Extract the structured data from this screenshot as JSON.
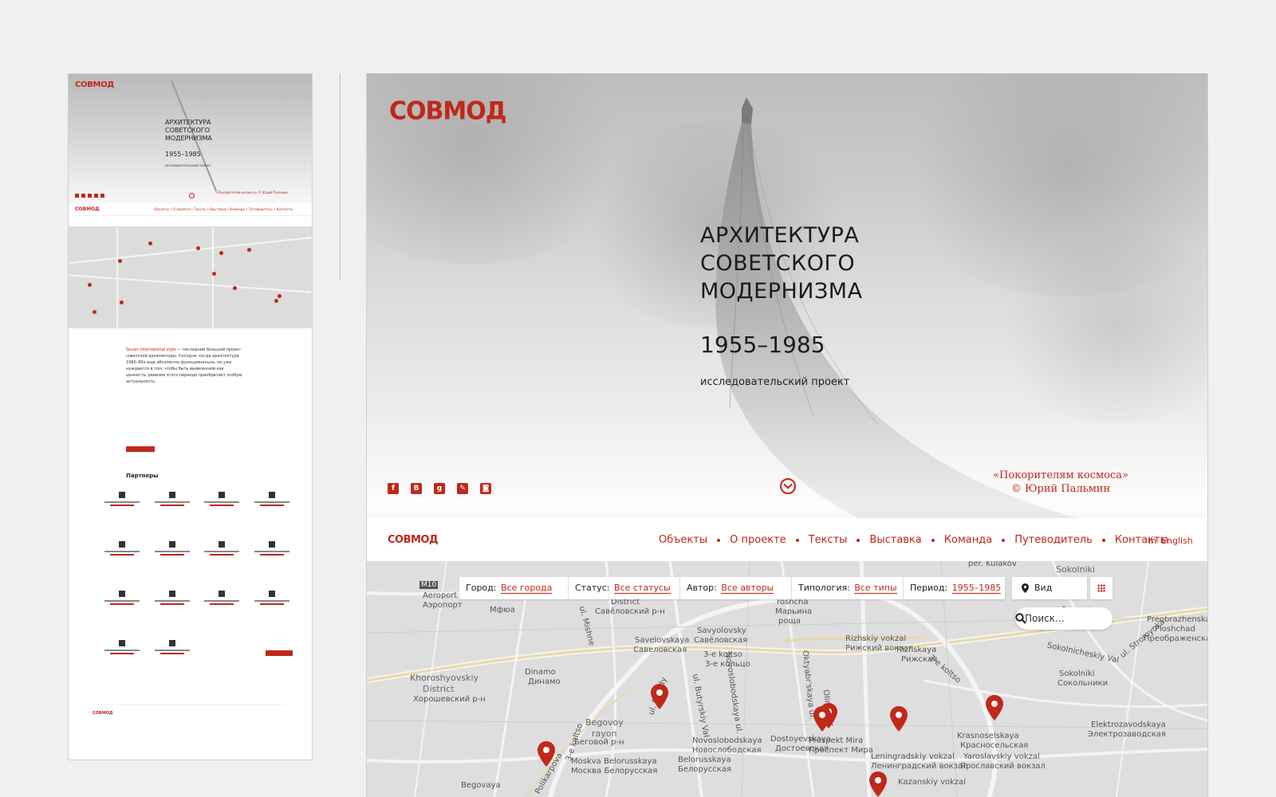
{
  "thumb": {
    "logo": "СОВМОД",
    "title": "АРХИТЕКТУРА СОВЕТСКОГО МОДЕРНИЗМА",
    "years": "1955–1985",
    "subtitle": "исследовательский проект",
    "credit": "«Покорителям космоса» © Юрий Пальмин",
    "nav": "Объекты • О проекте • Тексты • Выставка • Команда • Путеводитель • Контакты",
    "intro_highlight": "Soviet international style",
    "intro_text": " — последний большой проект советской архитектуры. Сегодня, когда архитектура 1960–80х еще абсолютно функциональна, но уже нуждается в том, чтобы быть выявленной как ценность, ревизия этого периода приобретает особую актуальность.",
    "partners_title": "Партнеры"
  },
  "hero": {
    "logo": "СОВМОД",
    "title_lines": [
      "АРХИТЕКТУРА",
      "СОВЕТСКОГО",
      "МОДЕРНИЗМА"
    ],
    "years": "1955–1985",
    "subtitle": "исследовательский проект",
    "credit_line1": "«Покорителям космоса»",
    "credit_line2": "© Юрий Пальмин",
    "social": [
      "f",
      "В",
      "g",
      "✎",
      "◙"
    ]
  },
  "nav": {
    "logo": "СОВМОД",
    "items": [
      "Объекты",
      "О проекте",
      "Тексты",
      "Выставка",
      "Команда",
      "Путеводитель",
      "Контакты"
    ],
    "lang_prefix": "in",
    "lang": "English"
  },
  "filters": [
    {
      "label": "Город:",
      "value": "Все города"
    },
    {
      "label": "Статус:",
      "value": "Все статусы"
    },
    {
      "label": "Автор:",
      "value": "Все авторы"
    },
    {
      "label": "Типология:",
      "value": "Все типы"
    },
    {
      "label": "Период:",
      "value": "1955–1985"
    }
  ],
  "map_controls": {
    "view_label": "Вид картой",
    "search_placeholder": "Поиск..."
  },
  "map_labels": {
    "m10": "M10",
    "aeroport": "Aeroport",
    "aeroport_ru": "Аэропорт",
    "mfua": "Мфюа",
    "district": "District",
    "savelovsky_r": "Савёловский р-н",
    "roshcha": "roshcha",
    "marina": "Марьина",
    "roshcha_ru": "роща",
    "savelovskaya": "Savelovskaya",
    "savelovskaya_ru": "Савеловская",
    "savyolovsky": "Savyolovsky",
    "savyolovskaya_ru": "Савёловская",
    "rizhsky_vokzal": "Rizhskiy vokzal",
    "rizhsky_vokzal_ru": "Рижский вокзал",
    "rizhskaya": "Rizhskaya",
    "rizhskaya_ru": "Рижская",
    "koltso": "3-e koltso",
    "koltso_ru": "3-е кольцо",
    "koltso2": "3-e koltso",
    "khoroshevsky": "Khoroshyovskiy",
    "khoroshevsky2": "District",
    "khoroshevsky_ru": "Хорошевский р-н",
    "dinamo": "Dinamo",
    "dinamo_ru": "Динамо",
    "begovoy": "Begovoy",
    "begovoy2": "rayon",
    "begovoy_ru": "Беговой р-н",
    "novoslobodskaya": "Novoslobodskaya",
    "novoslobodskaya_ru": "Новослободская",
    "dostoyevskaya": "Dostoyevskaya",
    "dostoyevskaya_ru": "Достоевская",
    "prospekt_mira": "Prospekt Mira",
    "prospekt_mira_ru": "Проспект Мира",
    "moskva_bel": "Moskva Belorusskaya",
    "moskva_bel_ru": "Москва Белорусская",
    "belorusskaya": "Belorusskaya",
    "belorusskaya_ru": "Белорусская",
    "begovaya": "Begovaya",
    "leningradsky": "Leningradskiy vokzal",
    "leningradsky_ru": "Ленинградский вокзал",
    "yaroslavsky": "Yaroslavskiy vokzal",
    "yaroslavsky_ru": "Ярославский вокзал",
    "kazansky": "Kazanskiy vokzal",
    "krasnoselskaya": "Krasnoselskaya",
    "krasnoselskaya_ru": "Красносельская",
    "sokolniki": "Sokolniki",
    "sokolniki_ru": "Сокольники",
    "sokolniki_top": "Sokolniki",
    "sokolnicheskiy": "Sokolnicheskiy Val",
    "preobrazhenskaya": "Preobrazhenska",
    "ploshchad": "Ploshchad",
    "preobr_ru": "Преображенская",
    "elektrozavodskaya": "Elektrozavodskaya",
    "elektrozavodskaya_ru": "Электрозаводская",
    "kulakov": "per. Kulakov",
    "stromynka": "ul. Stromynka",
    "pravdy": "ul. Pravdy",
    "butyrskiy": "ul. Butyrskiy Val",
    "novoslob_street": "Novoslobodskaya ul.",
    "okt": "Oktyabr'skaya ul.",
    "polikarpova": "ul. Polikarpova",
    "koltso_vert": "3-e koltso",
    "mishne": "ul. Mishne",
    "olimp": "Olimp. pr."
  }
}
